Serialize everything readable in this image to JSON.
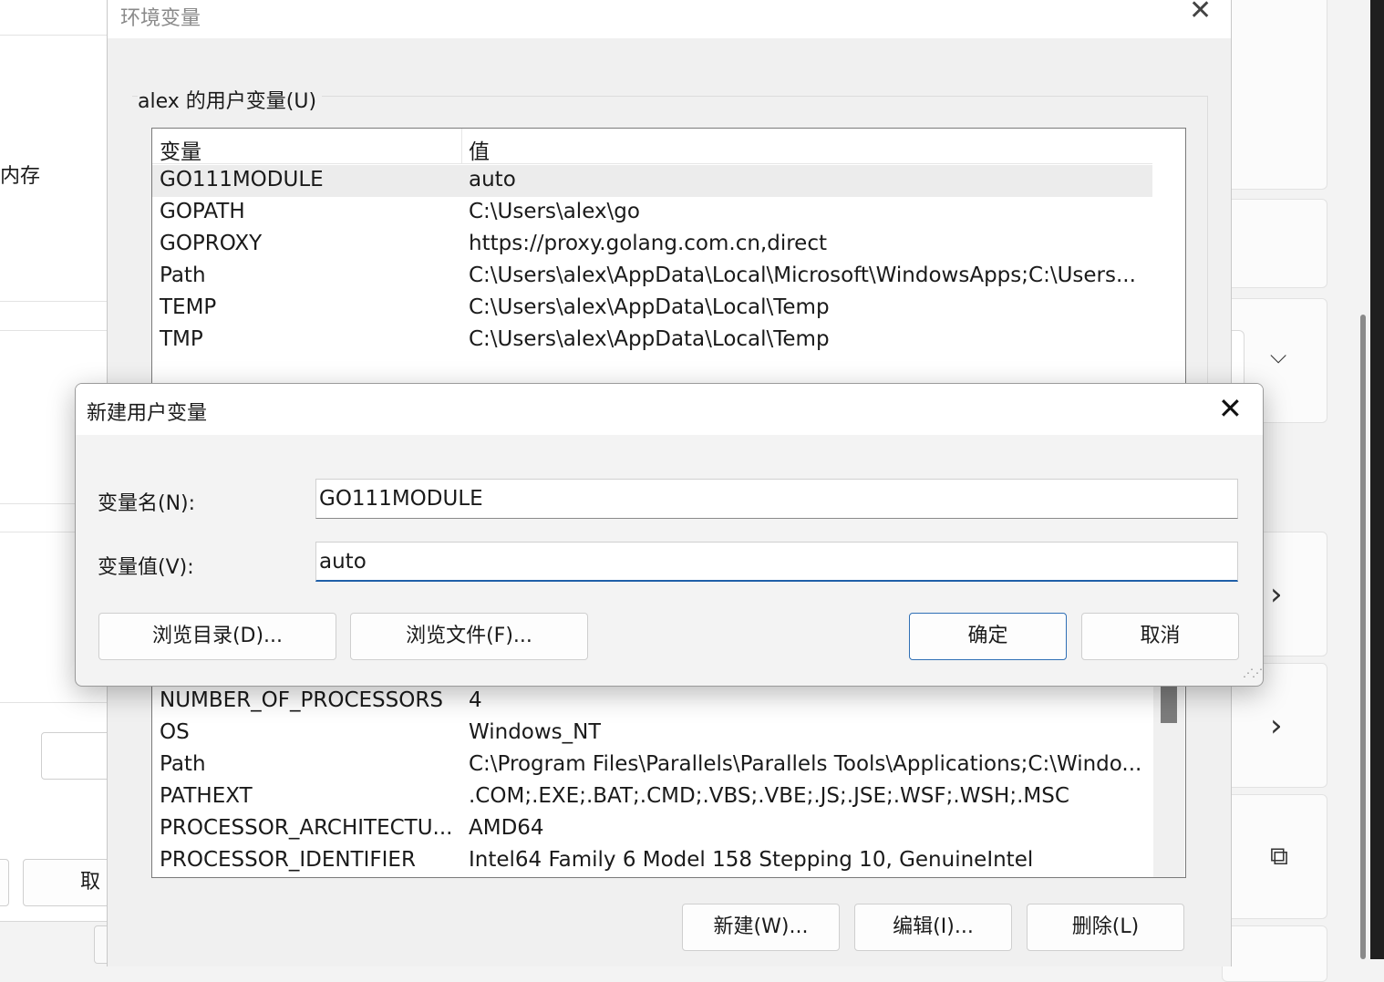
{
  "background": {
    "left_label": "内存",
    "left_cancel": "取消"
  },
  "env_window": {
    "title": "环境变量",
    "close_glyph": "✕",
    "user_group_label": "alex 的用户变量(U)",
    "columns": {
      "variable": "变量",
      "value": "值"
    },
    "user_vars": [
      {
        "name": "GO111MODULE",
        "value": "auto"
      },
      {
        "name": "GOPATH",
        "value": "C:\\Users\\alex\\go"
      },
      {
        "name": "GOPROXY",
        "value": "https://proxy.golang.com.cn,direct"
      },
      {
        "name": "Path",
        "value": "C:\\Users\\alex\\AppData\\Local\\Microsoft\\WindowsApps;C:\\Users..."
      },
      {
        "name": "TEMP",
        "value": "C:\\Users\\alex\\AppData\\Local\\Temp"
      },
      {
        "name": "TMP",
        "value": "C:\\Users\\alex\\AppData\\Local\\Temp"
      }
    ],
    "system_vars": [
      {
        "name": "NUMBER_OF_PROCESSORS",
        "value": "4"
      },
      {
        "name": "OS",
        "value": "Windows_NT"
      },
      {
        "name": "Path",
        "value": "C:\\Program Files\\Parallels\\Parallels Tools\\Applications;C:\\Windo..."
      },
      {
        "name": "PATHEXT",
        "value": ".COM;.EXE;.BAT;.CMD;.VBS;.VBE;.JS;.JSE;.WSF;.WSH;.MSC"
      },
      {
        "name": "PROCESSOR_ARCHITECTU...",
        "value": "AMD64"
      },
      {
        "name": "PROCESSOR_IDENTIFIER",
        "value": "Intel64 Family 6 Model 158 Stepping 10, GenuineIntel"
      }
    ],
    "buttons": {
      "new": "新建(W)...",
      "edit": "编辑(I)...",
      "delete": "删除(L)"
    }
  },
  "dialog": {
    "title": "新建用户变量",
    "close_glyph": "✕",
    "name_label": "变量名(N):",
    "name_value": "GO111MODULE",
    "value_label": "变量值(V):",
    "value_value": "auto",
    "browse_dir": "浏览目录(D)...",
    "browse_file": "浏览文件(F)...",
    "ok": "确定",
    "cancel": "取消"
  },
  "right_panel": {
    "chevron_down": "⌵",
    "chevron_right": "›",
    "external_link": "⧉"
  }
}
